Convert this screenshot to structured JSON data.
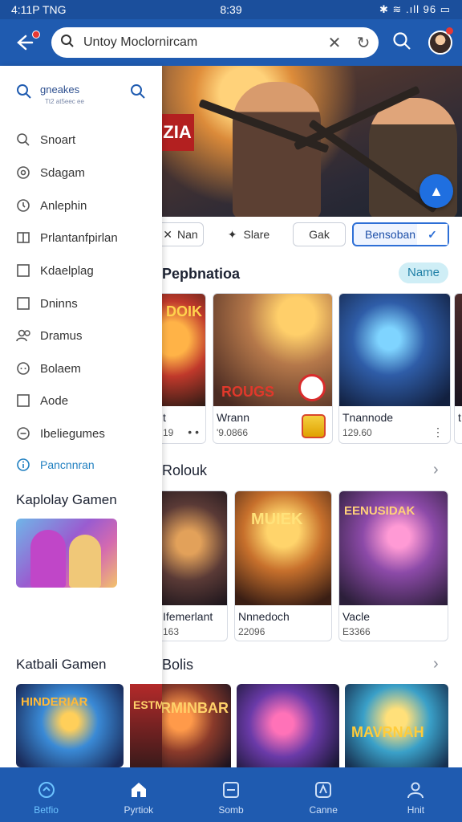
{
  "status_bar": {
    "left": "4:11P TNG",
    "time": "8:39",
    "right": "✱ ≋ .ıll 96 ▭"
  },
  "app_bar": {
    "search_value": "Untoy Moclornircam"
  },
  "chips": [
    {
      "label": "Nan",
      "icon": "tools-icon"
    },
    {
      "label": "Slare",
      "icon": "pin-icon"
    },
    {
      "label": "Gak",
      "icon": ""
    },
    {
      "label": "Bensoban",
      "icon": "check-icon",
      "active": true
    }
  ],
  "sections": {
    "featured_title": "Pepbnatioa",
    "featured_badge": "Name",
    "row2_title": "Rolouk",
    "row3_title": "Bolis"
  },
  "featured_cards": [
    {
      "title": "t",
      "meta": "19",
      "art": "DOIK"
    },
    {
      "title": "Wrann",
      "meta": "'9.0866",
      "art": "ROUGS"
    },
    {
      "title": "Tnannode",
      "meta": "129.60",
      "art": ""
    },
    {
      "title": "t",
      "meta": "",
      "art": ""
    }
  ],
  "row2_cards": [
    {
      "title": "Ifemerlant",
      "meta": "163",
      "art": ""
    },
    {
      "title": "Nnnedoch",
      "meta": "22096",
      "art": "MUIEK"
    },
    {
      "title": "Vacle",
      "meta": "E3366",
      "art": "EENUSIDAK"
    }
  ],
  "row3_cards": [
    {
      "art": "ERMINBAR"
    },
    {
      "art": ""
    },
    {
      "art": "MAVRNAH"
    }
  ],
  "drawer": {
    "search_label": "gneakes",
    "search_sub": "Tt2 at5eec ee",
    "items": [
      {
        "label": "Snoart",
        "icon": "search-icon"
      },
      {
        "label": "Sdagam",
        "icon": "settings-icon"
      },
      {
        "label": "Anlephin",
        "icon": "clock-icon"
      },
      {
        "label": "Prlantanfpirlan",
        "icon": "book-icon"
      },
      {
        "label": "Kdaelplag",
        "icon": "square-icon"
      },
      {
        "label": "Dninns",
        "icon": "square-icon"
      },
      {
        "label": "Dramus",
        "icon": "people-icon"
      },
      {
        "label": "Bolaem",
        "icon": "gamepad-icon"
      },
      {
        "label": "Aode",
        "icon": "square-icon"
      },
      {
        "label": "Ibeliegumes",
        "icon": "minus-circle-icon"
      },
      {
        "label": "Pancnnran",
        "icon": "info-icon",
        "accent": true
      }
    ],
    "section1_title": "Kaplolay Gamen",
    "section2_title": "Katbali Gamen",
    "thumbs_art": [
      "HINDERIAR",
      "ESTMIR"
    ]
  },
  "bottom_nav": [
    {
      "label": "Betfio",
      "icon": "home-icon",
      "active": true
    },
    {
      "label": "Pyrtiok",
      "icon": "house-icon"
    },
    {
      "label": "Somb",
      "icon": "grid-icon"
    },
    {
      "label": "Canne",
      "icon": "compass-icon"
    },
    {
      "label": "Hnit",
      "icon": "person-icon"
    }
  ],
  "colors": {
    "primary": "#1f5bb0",
    "status": "#1b4f9c",
    "accent": "#2d6fd6",
    "badge_bg": "#cfeef6"
  }
}
